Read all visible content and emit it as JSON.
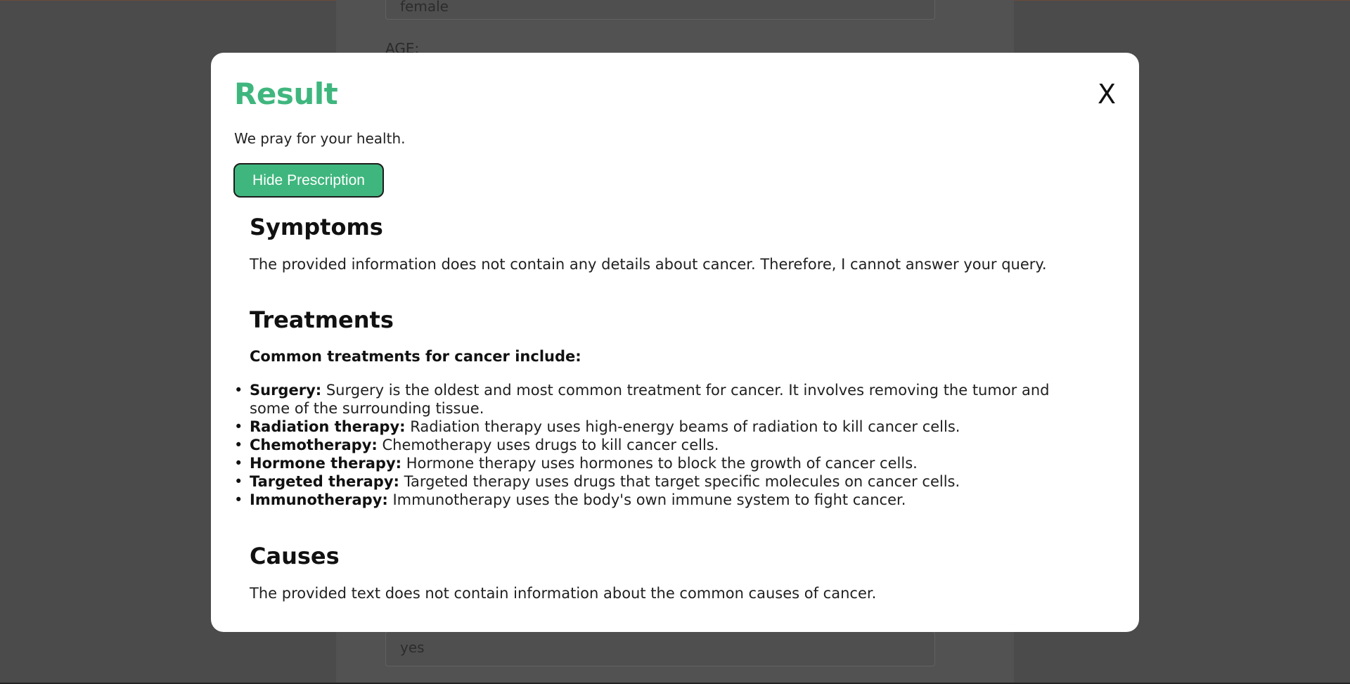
{
  "background": {
    "top_field_value": "female",
    "age_label": "AGE:",
    "bottom_field_value": "yes"
  },
  "modal": {
    "title": "Result",
    "close_label": "X",
    "subtitle": "We pray for your health.",
    "hide_button_label": "Hide Prescription",
    "symptoms": {
      "heading": "Symptoms",
      "text": "The provided information does not contain any details about cancer. Therefore, I cannot answer your query."
    },
    "treatments": {
      "heading": "Treatments",
      "intro": "Common treatments for cancer include:",
      "items": [
        {
          "name": "Surgery:",
          "text": " Surgery is the oldest and most common treatment for cancer. It involves removing the tumor and some of the surrounding tissue."
        },
        {
          "name": "Radiation therapy:",
          "text": " Radiation therapy uses high-energy beams of radiation to kill cancer cells."
        },
        {
          "name": "Chemotherapy:",
          "text": " Chemotherapy uses drugs to kill cancer cells."
        },
        {
          "name": "Hormone therapy:",
          "text": " Hormone therapy uses hormones to block the growth of cancer cells."
        },
        {
          "name": "Targeted therapy:",
          "text": " Targeted therapy uses drugs that target specific molecules on cancer cells."
        },
        {
          "name": "Immunotherapy:",
          "text": " Immunotherapy uses the body's own immune system to fight cancer."
        }
      ]
    },
    "causes": {
      "heading": "Causes",
      "text": "The provided text does not contain information about the common causes of cancer."
    }
  },
  "colors": {
    "accent": "#3fb67e",
    "overlay": "#4b4b4b"
  }
}
